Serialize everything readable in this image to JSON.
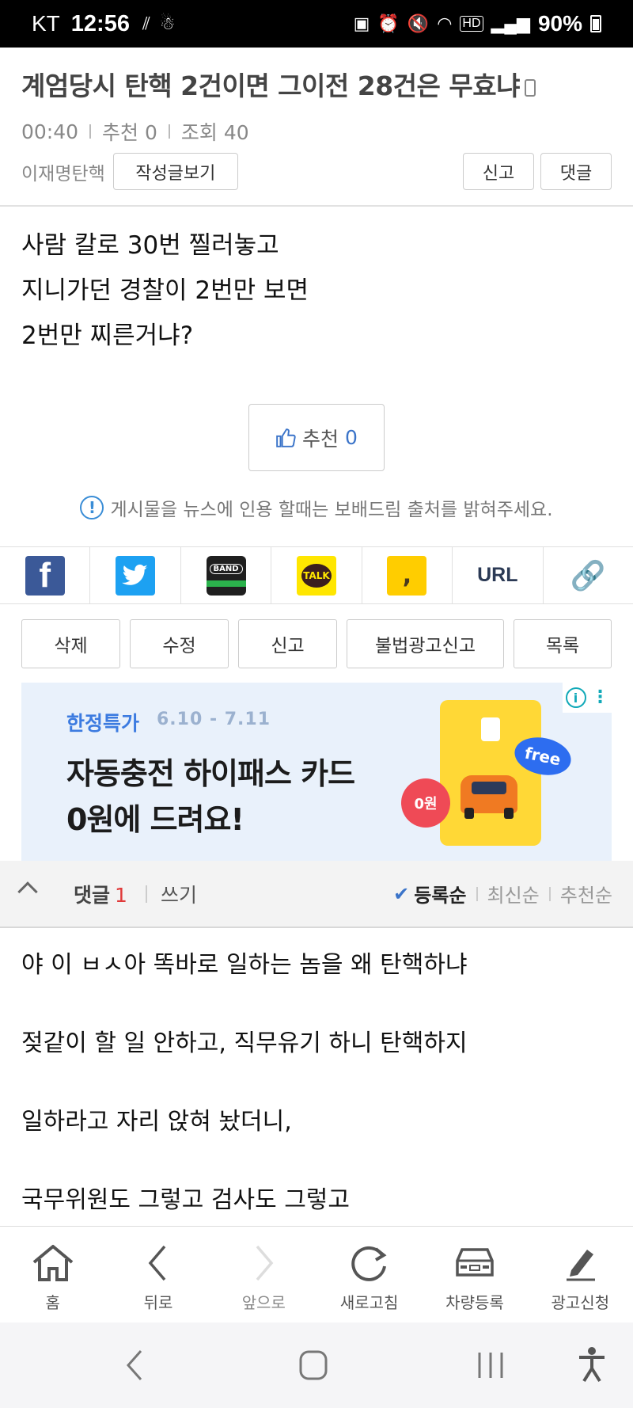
{
  "status_bar": {
    "carrier": "KT",
    "time": "12:56",
    "network": "HD",
    "battery": "90%"
  },
  "post": {
    "title": "계엄당시 탄핵 2건이면 그이전 28건은 무효냐",
    "time": "00:40",
    "recommend_meta": "추천 0",
    "views_meta": "조회 40",
    "author": "이재명탄핵",
    "view_posts_label": "작성글보기",
    "report_label": "신고",
    "comment_label": "댓글",
    "body_lines": [
      "사람 칼로 30번 찔러놓고",
      "지니가던 경찰이 2번만 보면",
      "2번만 찌른거냐?"
    ],
    "recommend_label": "추천",
    "recommend_count": "0",
    "notice": "게시물을 뉴스에 인용 할때는 보배드림 출처를 밝혀주세요."
  },
  "share": {
    "items": [
      "facebook-icon",
      "twitter-icon",
      "band-icon",
      "kakaotalk-icon",
      "kakaostory-icon",
      "URL",
      "clip-icon"
    ],
    "band_label": "BAND",
    "talk_label": "TALK",
    "url_label": "URL"
  },
  "actions": {
    "delete": "삭제",
    "edit": "수정",
    "report": "신고",
    "illegal_ad_report": "불법광고신고",
    "list": "목록"
  },
  "ad": {
    "tag": "한정특가",
    "date": "6.10 - 7.11",
    "line1": "자동충전 하이패스 카드",
    "line2": "0원에 드려요!",
    "badge_zero": "0원",
    "badge_free": "free"
  },
  "comments": {
    "label": "댓글",
    "count": "1",
    "write": "쓰기",
    "sort_registered": "등록순",
    "sort_latest": "최신순",
    "sort_recommended": "추천순",
    "lines": [
      "야 이 ㅂㅅ아 똑바로 일하는 놈을 왜 탄핵하냐",
      "젖같이 할 일 안하고, 직무유기 하니 탄핵하지",
      "일하라고 자리 앉혀 놨더니,",
      "국무위원도 그렇고 검사도 그렇고"
    ]
  },
  "bottom_nav": {
    "home": "홈",
    "back": "뒤로",
    "forward": "앞으로",
    "refresh": "새로고침",
    "vehicle": "차량등록",
    "ad_apply": "광고신청"
  },
  "colors": {
    "accent_blue": "#3b74c9",
    "comment_count_red": "#e03a3a",
    "facebook": "#3b5998",
    "twitter": "#1da1f2",
    "kakao_yellow": "#ffe600"
  }
}
